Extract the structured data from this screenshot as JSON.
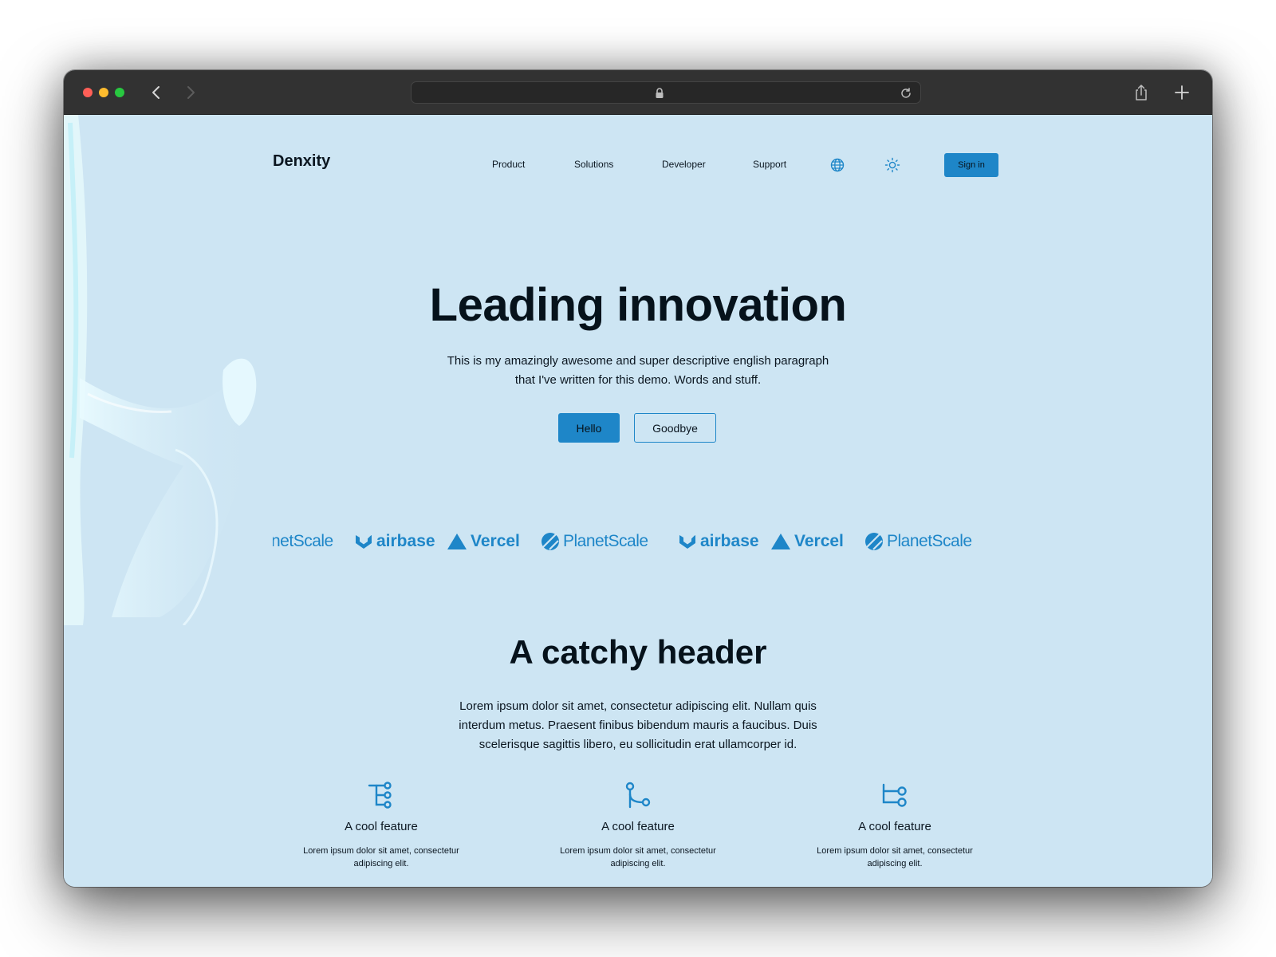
{
  "browser": {
    "controls": [
      "close",
      "minimize",
      "zoom"
    ],
    "icons": [
      "chevron-left-icon",
      "chevron-right-icon",
      "lock-icon",
      "reload-icon",
      "share-icon",
      "plus-icon"
    ]
  },
  "header": {
    "brand": "Denxity",
    "nav": [
      "Product",
      "Solutions",
      "Developer",
      "Support"
    ],
    "sign_in": "Sign in"
  },
  "hero": {
    "title": "Leading innovation",
    "subtitle_line1": "This is my amazingly awesome and super descriptive english paragraph",
    "subtitle_line2": "that I've written for this demo. Words and stuff.",
    "primary_button": "Hello",
    "secondary_button": "Goodbye"
  },
  "logos": [
    {
      "name": "PlanetScale",
      "visible_text": "netScale"
    },
    {
      "name": "airbase",
      "visible_text": "airbase"
    },
    {
      "name": "Vercel",
      "visible_text": "Vercel"
    },
    {
      "name": "PlanetScale",
      "visible_text": "PlanetScale"
    },
    {
      "name": "airbase",
      "visible_text": "airbase"
    },
    {
      "name": "Vercel",
      "visible_text": "Vercel"
    },
    {
      "name": "PlanetScale",
      "visible_text": "PlanetScale"
    }
  ],
  "section": {
    "title": "A catchy header",
    "body_line1": "Lorem ipsum dolor sit amet, consectetur adipiscing elit. Nullam quis",
    "body_line2": "interdum metus. Praesent finibus bibendum mauris a faucibus. Duis",
    "body_line3": "scelerisque sagittis libero, eu sollicitudin erat ullamcorper id."
  },
  "features": [
    {
      "icon": "tree-hierarchy-icon",
      "title": "A cool feature",
      "desc_line1": "Lorem ipsum dolor sit amet, consectetur",
      "desc_line2": "adipiscing elit."
    },
    {
      "icon": "git-merge-icon",
      "title": "A cool feature",
      "desc_line1": "Lorem ipsum dolor sit amet, consectetur",
      "desc_line2": "adipiscing elit."
    },
    {
      "icon": "git-branch-icon",
      "title": "A cool feature",
      "desc_line1": "Lorem ipsum dolor sit amet, consectetur",
      "desc_line2": "adipiscing elit."
    }
  ],
  "colors": {
    "page_background": "#cde5f3",
    "accent": "#1e86c8",
    "text": "#0b1620",
    "titlebar": "#323232"
  }
}
